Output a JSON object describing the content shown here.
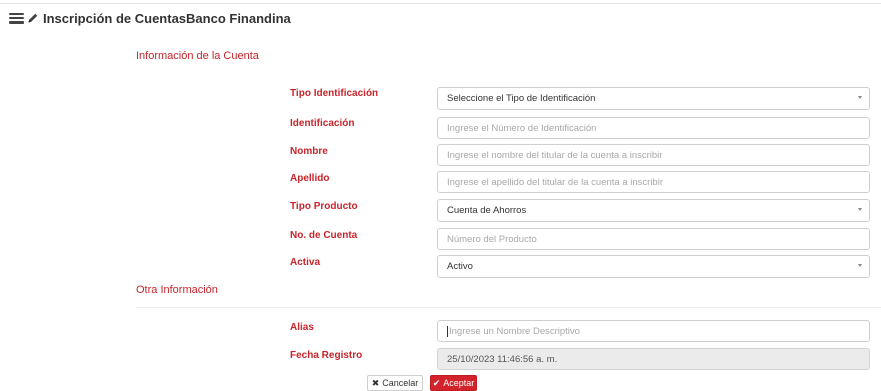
{
  "header": {
    "title": "Inscripción de CuentasBanco Finandina",
    "menu_icon": "hamburger-icon",
    "edit_icon": "pencil-icon"
  },
  "sections": {
    "account_info": "Información de la Cuenta",
    "other_info": "Otra Información"
  },
  "form": {
    "tipo_identificacion": {
      "label": "Tipo Identificación",
      "value": "Seleccione el Tipo de Identificación"
    },
    "identificacion": {
      "label": "Identificación",
      "placeholder": "Ingrese el Número de Identificación"
    },
    "nombre": {
      "label": "Nombre",
      "placeholder": "Ingrese el nombre del titular de la cuenta a inscribir"
    },
    "apellido": {
      "label": "Apellido",
      "placeholder": "Ingrese el apellido del titular de la cuenta a inscribir"
    },
    "tipo_producto": {
      "label": "Tipo Producto",
      "value": "Cuenta de Ahorros"
    },
    "no_cuenta": {
      "label": "No. de Cuenta",
      "placeholder": "Número del Producto"
    },
    "activa": {
      "label": "Activa",
      "value": "Activo"
    },
    "alias": {
      "label": "Alias",
      "placeholder": "Ingrese un Nombre Descriptivo"
    },
    "fecha_registro": {
      "label": "Fecha Registro",
      "value": "25/10/2023 11:46:56 a. m."
    }
  },
  "buttons": {
    "cancel": "Cancelar",
    "cancel_icon": "times-icon",
    "accept": "Aceptar",
    "accept_icon": "check-icon"
  },
  "colors": {
    "accent": "#c8242b",
    "button_primary": "#d2222a",
    "disabled_field": "#ebebeb"
  }
}
